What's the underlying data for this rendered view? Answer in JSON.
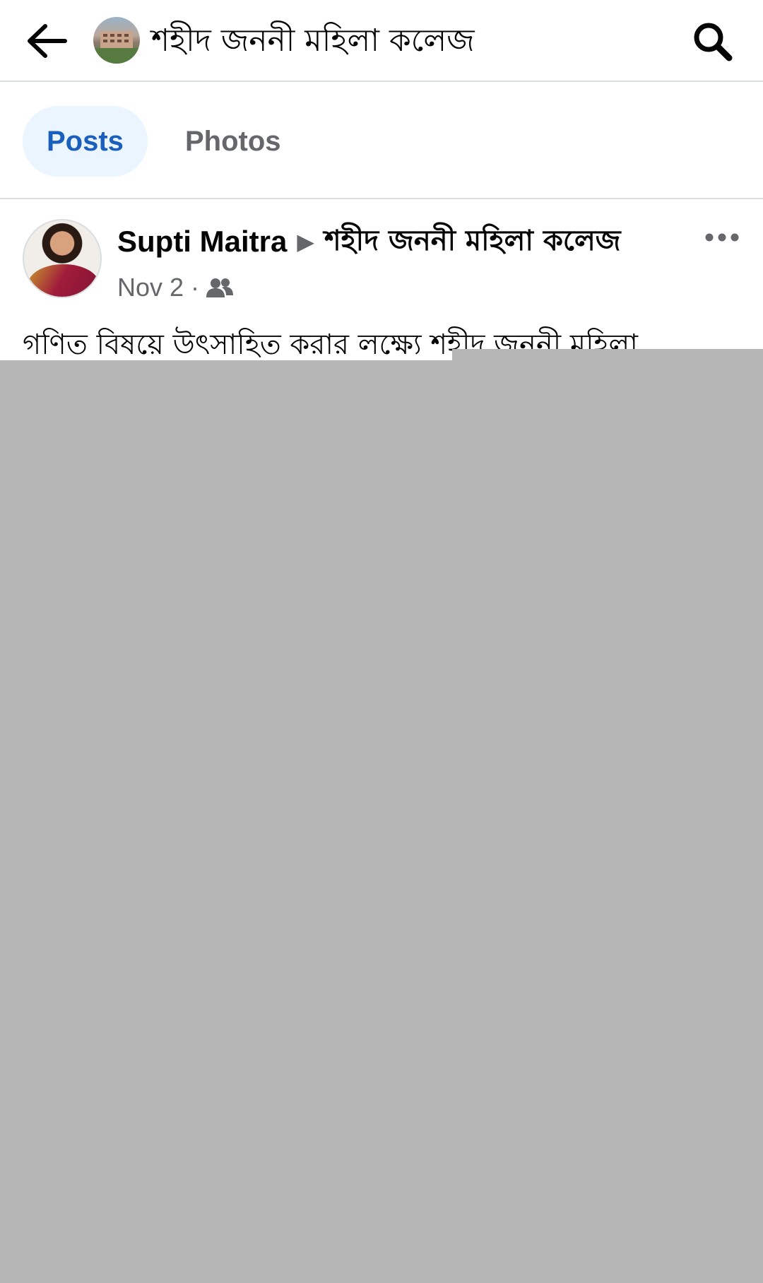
{
  "header": {
    "back_icon": "arrow-left-icon",
    "group_title": "শহীদ জননী মহিলা কলেজ",
    "search_icon": "search-icon"
  },
  "tabs": [
    {
      "label": "Posts",
      "active": true
    },
    {
      "label": "Photos",
      "active": false
    }
  ],
  "post": {
    "author": "Supti Maitra",
    "arrow": "▶",
    "group": "শহীদ জননী মহিলা কলেজ",
    "date": "Nov 2",
    "separator": "·",
    "audience_icon": "members-icon",
    "more_icon": "more-horizontal-icon",
    "text": "গণিত বিষয়ে উৎসাহিত করার লক্ষ্যে শহীদ জননী মহিলা"
  },
  "colors": {
    "accent": "#1b5fbd",
    "tab_active_bg": "#ebf5ff",
    "secondary_text": "#65676b",
    "divider": "#dadde1",
    "placeholder": "#b6b6b6"
  }
}
